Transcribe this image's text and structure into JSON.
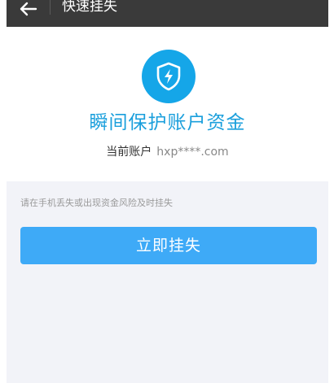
{
  "header": {
    "title": "快速挂失",
    "back_icon": "arrow-left-icon"
  },
  "card": {
    "icon": "shield-lightning-icon",
    "icon_color": "#15a6e8",
    "headline": "瞬间保护账户资金",
    "account_label": "当前账户",
    "account_value": "hxp****.com"
  },
  "hint": "请在手机丢失或出现资金风险及时挂失",
  "primary_button": {
    "label": "立即挂失",
    "color": "#3eaaf7"
  }
}
